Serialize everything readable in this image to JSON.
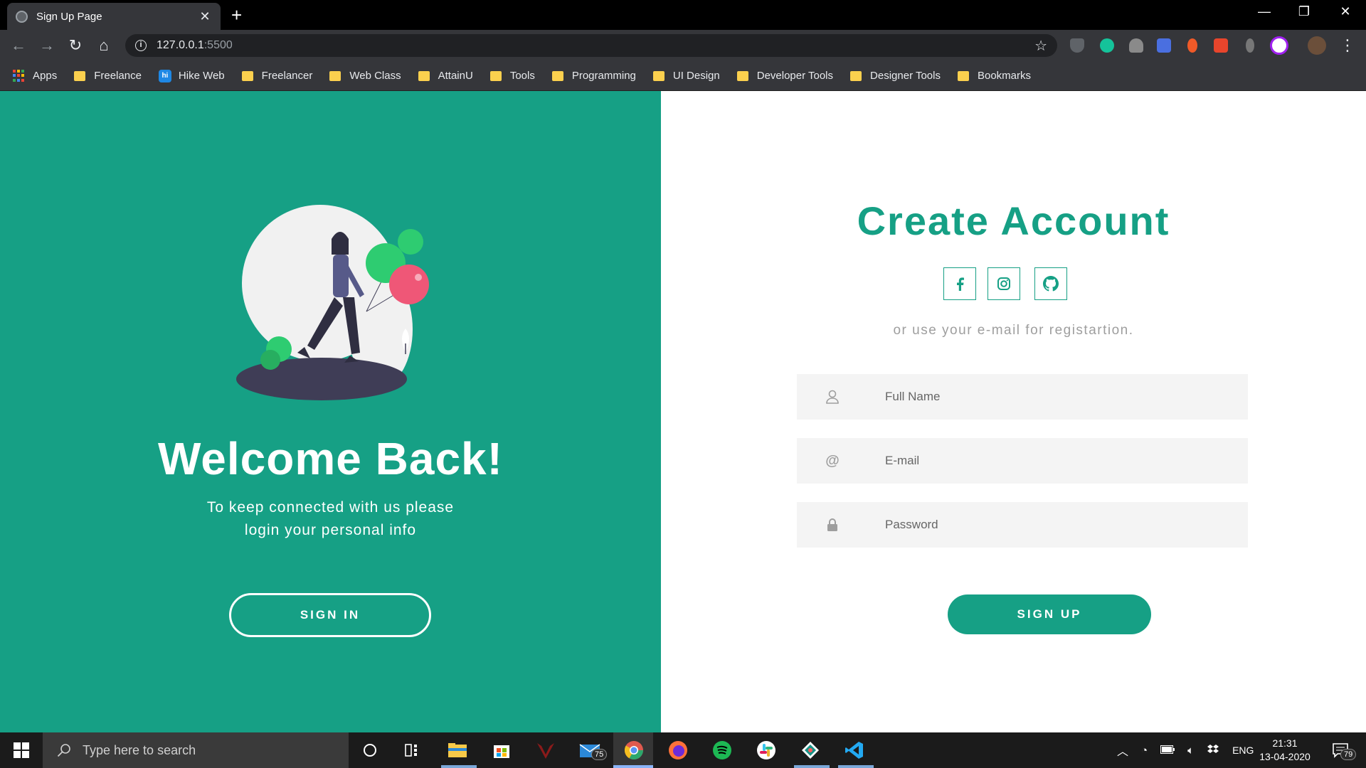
{
  "browser": {
    "tab_title": "Sign Up Page",
    "url_host": "127.0.0.1",
    "url_port": ":5500",
    "bookmarks": [
      {
        "label": "Apps",
        "icon": "apps-grid-icon"
      },
      {
        "label": "Freelance",
        "icon": "folder-icon"
      },
      {
        "label": "Hike Web",
        "icon": "hike-icon"
      },
      {
        "label": "Freelancer",
        "icon": "folder-icon"
      },
      {
        "label": "Web Class",
        "icon": "folder-icon"
      },
      {
        "label": "AttainU",
        "icon": "folder-icon"
      },
      {
        "label": "Tools",
        "icon": "folder-icon"
      },
      {
        "label": "Programming",
        "icon": "folder-icon"
      },
      {
        "label": "UI Design",
        "icon": "folder-icon"
      },
      {
        "label": "Developer Tools",
        "icon": "folder-icon"
      },
      {
        "label": "Designer Tools",
        "icon": "folder-icon"
      },
      {
        "label": "Bookmarks",
        "icon": "folder-icon"
      }
    ]
  },
  "left_panel": {
    "heading": "Welcome Back!",
    "subtext_line1": "To keep connected with us please",
    "subtext_line2": "login your personal info",
    "signin_label": "SIGN IN",
    "bg_color": "#16a085"
  },
  "right_panel": {
    "heading": "Create Account",
    "socials": [
      "facebook-icon",
      "instagram-icon",
      "github-icon"
    ],
    "or_text": "or use your e-mail for registartion.",
    "fields": [
      {
        "placeholder": "Full Name",
        "icon": "user-icon"
      },
      {
        "placeholder": "E-mail",
        "icon": "at-sign-icon"
      },
      {
        "placeholder": "Password",
        "icon": "lock-icon"
      }
    ],
    "signup_label": "SIGN UP",
    "accent_color": "#16a085"
  },
  "taskbar": {
    "search_placeholder": "Type here to search",
    "mail_badge": "75",
    "language": "ENG",
    "time": "21:31",
    "date": "13-04-2020",
    "notification_count": "79"
  }
}
